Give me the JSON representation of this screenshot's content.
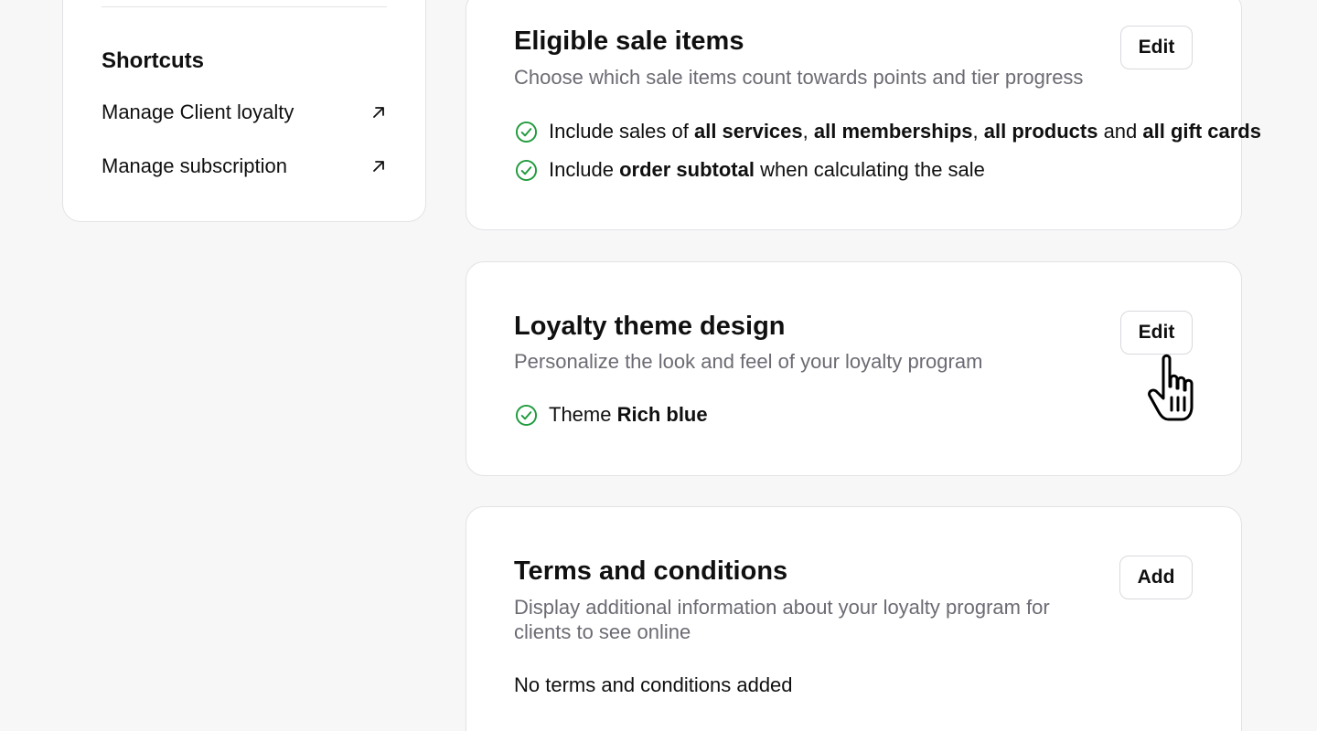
{
  "shortcuts": {
    "title": "Shortcuts",
    "links": [
      {
        "label": "Manage Client loyalty",
        "icon": "external-arrow-icon"
      },
      {
        "label": "Manage subscription",
        "icon": "external-arrow-icon"
      }
    ]
  },
  "cards": {
    "eligible": {
      "title": "Eligible sale items",
      "description": "Choose which sale items count towards points and tier progress",
      "button": "Edit",
      "row1": {
        "t1": "Include sales of ",
        "b1": "all services",
        "t2": ", ",
        "b2": "all memberships",
        "t3": ", ",
        "b3": "all products",
        "t4": " and ",
        "b4": "all gift cards"
      },
      "row2": {
        "t1": "Include ",
        "b1": "order subtotal",
        "t2": " when calculating the sale"
      }
    },
    "theme": {
      "title": "Loyalty theme design",
      "description": "Personalize the look and feel of your loyalty program",
      "button": "Edit",
      "row1": {
        "t1": "Theme ",
        "b1": "Rich blue"
      }
    },
    "terms": {
      "title": "Terms and conditions",
      "description": "Display additional information about your loyalty program for clients to see online",
      "button": "Add",
      "empty": "No terms and conditions added"
    }
  },
  "colors": {
    "check": "#1f9a3c",
    "muted_text": "#6b6b73",
    "border": "#e3e3e6",
    "background": "#f7f7f8"
  }
}
